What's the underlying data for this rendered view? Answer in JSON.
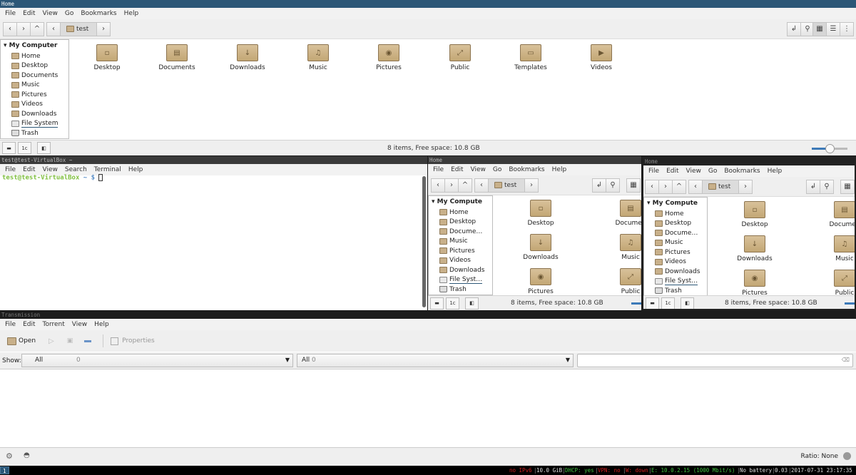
{
  "nemo_top": {
    "title": "Home",
    "menu": [
      "File",
      "Edit",
      "View",
      "Go",
      "Bookmarks",
      "Help"
    ],
    "path": "test",
    "sidebar_header": "My Computer",
    "sidebar": [
      "Home",
      "Desktop",
      "Documents",
      "Music",
      "Pictures",
      "Videos",
      "Downloads",
      "File System",
      "Trash"
    ],
    "files": [
      "Desktop",
      "Documents",
      "Downloads",
      "Music",
      "Pictures",
      "Public",
      "Templates",
      "Videos"
    ],
    "status": "8 items, Free space: 10.8 GB"
  },
  "terminal": {
    "title": "test@test-VirtualBox ~",
    "menu": [
      "File",
      "Edit",
      "View",
      "Search",
      "Terminal",
      "Help"
    ],
    "prompt_user": "test@test-VirtualBox",
    "prompt_rest": " ~ $ "
  },
  "nemo_a": {
    "title": "Home",
    "menu": [
      "File",
      "Edit",
      "View",
      "Go",
      "Bookmarks",
      "Help"
    ],
    "path": "test",
    "sidebar_header": "My Compute",
    "sidebar": [
      "Home",
      "Desktop",
      "Docume…",
      "Music",
      "Pictures",
      "Videos",
      "Downloads",
      "File Syst…",
      "Trash"
    ],
    "files": [
      "Desktop",
      "Documen",
      "Downloads",
      "Music",
      "Pictures",
      "Public"
    ],
    "status": "8 items, Free space: 10.8 GB"
  },
  "nemo_b": {
    "title": "Home",
    "menu": [
      "File",
      "Edit",
      "View",
      "Go",
      "Bookmarks",
      "Help"
    ],
    "path": "test",
    "sidebar_header": "My Compute",
    "sidebar": [
      "Home",
      "Desktop",
      "Docume…",
      "Music",
      "Pictures",
      "Videos",
      "Downloads",
      "File Syst…",
      "Trash"
    ],
    "files": [
      "Desktop",
      "Documen",
      "Downloads",
      "Music",
      "Pictures",
      "Public"
    ],
    "status": "8 items, Free space: 10.8 GB"
  },
  "transmission": {
    "title": "Transmission",
    "menu": [
      "File",
      "Edit",
      "Torrent",
      "View",
      "Help"
    ],
    "open": "Open",
    "properties": "Properties",
    "show": "Show:",
    "filter1": "All",
    "filter1_count": "0",
    "filter2": "All",
    "filter2_count": "0",
    "ratio": "Ratio: None"
  },
  "statusbar": {
    "workspace": "1",
    "ipv6": "no IPv6",
    "disk": "10.0 GiB",
    "dhcp": "DHCP: yes",
    "vpn": "VPN: no",
    "wlan": "W: down",
    "eth": "E: 10.0.2.15 (1000 Mbit/s)",
    "battery": "No battery",
    "load": "0.03",
    "datetime": "2017-07-31 23:17:35"
  },
  "colors": {
    "active_title": "#2c5777",
    "prompt": "#7fbf3f",
    "folder": "#c8b08a",
    "red": "#d02020",
    "green": "#40c040"
  }
}
